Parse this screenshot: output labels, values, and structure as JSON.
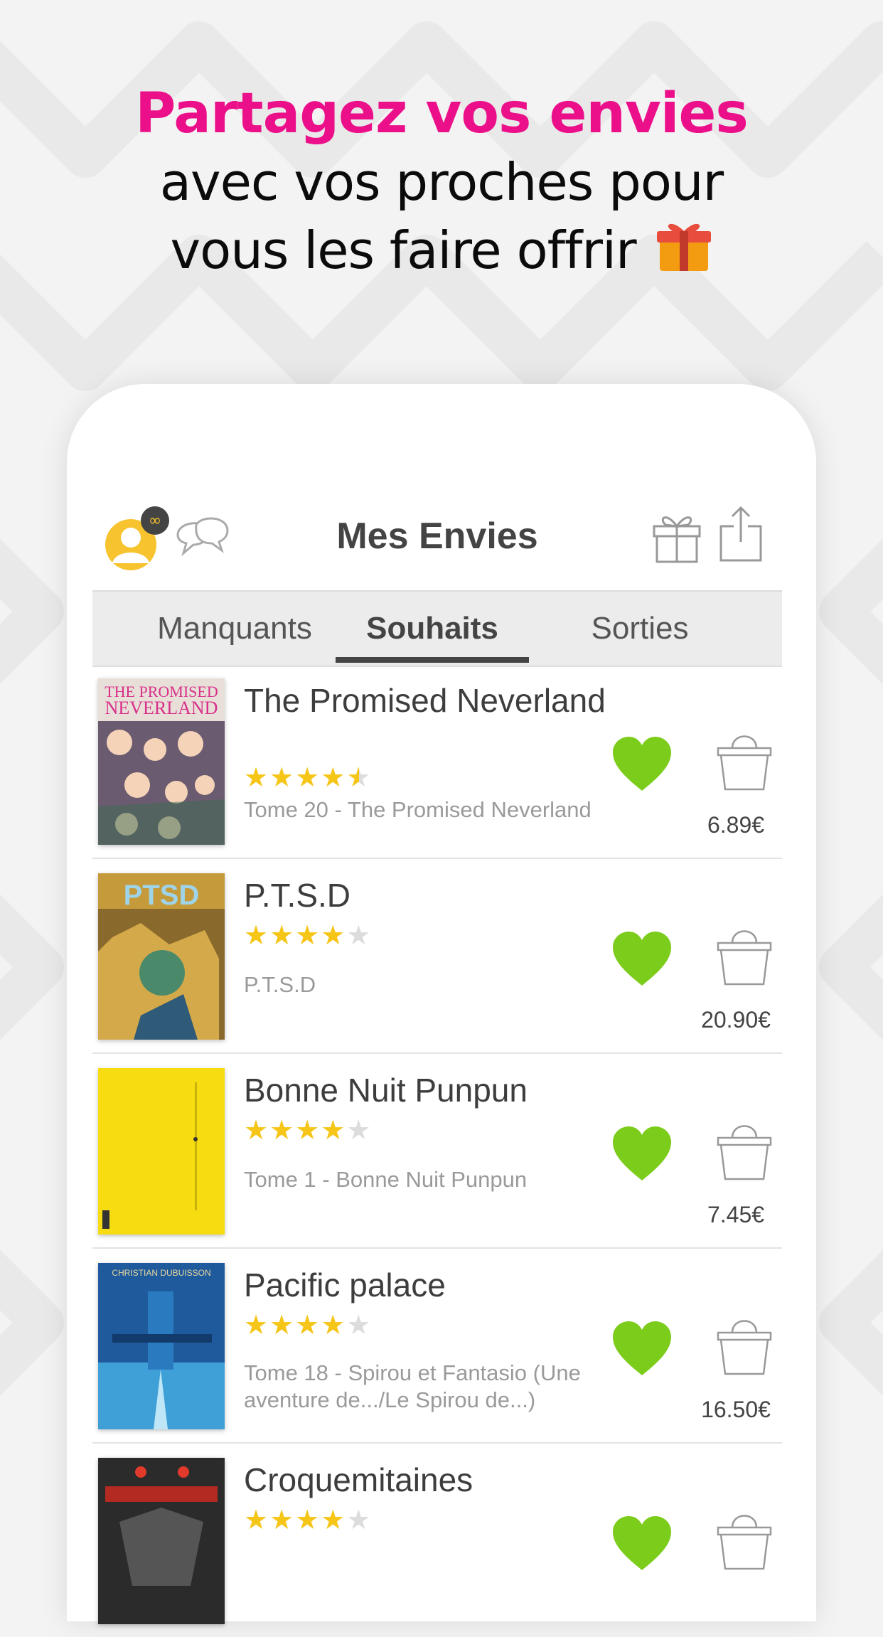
{
  "headline": {
    "line1": "Partagez vos envies",
    "line2": "avec vos proches pour",
    "line3": "vous les faire offrir",
    "emoji": "gift-emoji"
  },
  "header": {
    "title": "Mes Envies",
    "left_icons": [
      "avatar-icon",
      "chat-icon"
    ],
    "right_icons": [
      "gift-icon",
      "share-icon"
    ]
  },
  "tabs": [
    {
      "label": "Manquants",
      "active": false
    },
    {
      "label": "Souhaits",
      "active": true
    },
    {
      "label": "Sorties",
      "active": false
    }
  ],
  "colors": {
    "accent_pink": "#ec0f8a",
    "heart_green": "#7ccc1c",
    "star_yellow": "#f5c518",
    "avatar_yellow": "#f7c32e"
  },
  "items": [
    {
      "title": "The Promised Neverland",
      "rating": 4.5,
      "subtitle": "Tome 20 - The Promised Neverland",
      "price": "6.89€",
      "liked": true
    },
    {
      "title": "P.T.S.D",
      "rating": 4,
      "subtitle": "P.T.S.D",
      "price": "20.90€",
      "liked": true
    },
    {
      "title": "Bonne Nuit Punpun",
      "rating": 4,
      "subtitle": "Tome 1 - Bonne Nuit Punpun",
      "price": "7.45€",
      "liked": true
    },
    {
      "title": "Pacific palace",
      "rating": 4,
      "subtitle": "Tome 18 - Spirou et Fantasio (Une aventure de.../Le Spirou de...)",
      "price": "16.50€",
      "liked": true
    },
    {
      "title": "Croquemitaines",
      "rating": 4,
      "subtitle": "",
      "price": "",
      "liked": true
    }
  ]
}
